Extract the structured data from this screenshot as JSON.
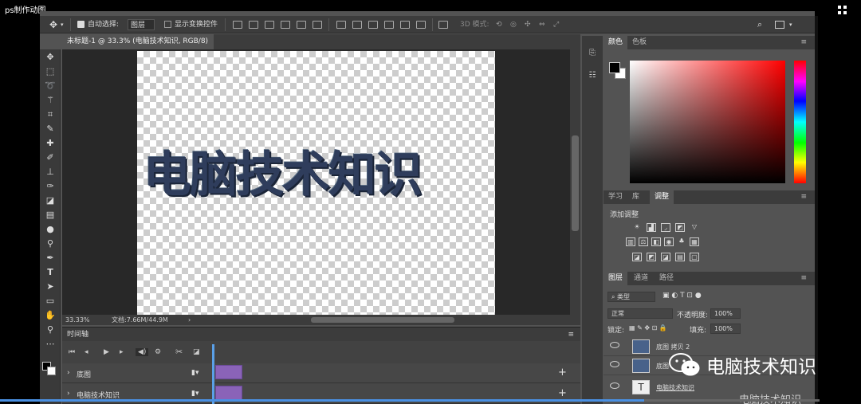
{
  "window": {
    "title": "ps制作动图"
  },
  "options": {
    "auto_select_label": "自动选择:",
    "auto_select_value": "图层",
    "transform_label": "显示变换控件",
    "mode3d_label": "3D 模式:"
  },
  "document": {
    "tab_title": "未标题-1 @ 33.3% (电脑技术知识, RGB/8) *",
    "canvas_text": "电脑技术知识",
    "zoom": "33.33%",
    "doc_size": "文档:7.66M/44.9M"
  },
  "timeline": {
    "title": "时间轴",
    "tracks": [
      {
        "label": "底图"
      },
      {
        "label": "电脑技术知识"
      }
    ]
  },
  "color_panel": {
    "tabs": [
      "颜色",
      "色板"
    ],
    "foreground": "#000000",
    "background": "#ffffff"
  },
  "adjust_panel": {
    "tabs": [
      "学习",
      "库",
      "调整"
    ],
    "title": "添加调整"
  },
  "layers_panel": {
    "tabs": [
      "图层",
      "通道",
      "路径"
    ],
    "filter": "类型",
    "blend_mode": "正常",
    "opacity_label": "不透明度:",
    "opacity": "100%",
    "lock_label": "锁定:",
    "fill_label": "填充:",
    "fill": "100%",
    "layers": [
      {
        "name": "底图 拷贝 2"
      },
      {
        "name": "底图"
      },
      {
        "name": "电脑技术知识"
      }
    ]
  },
  "watermark": {
    "main": "电脑技术知识",
    "secondary": "电脑技术知识"
  },
  "colors": {
    "accent": "#4a90e2",
    "clip": "#8a63b8"
  }
}
